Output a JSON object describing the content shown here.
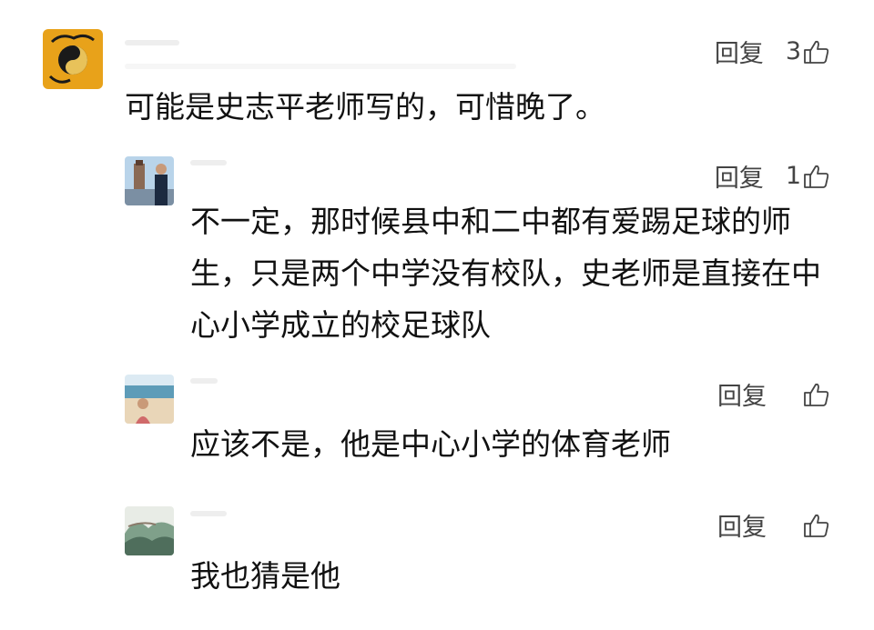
{
  "comments": [
    {
      "reply_label": "回复",
      "likes": "3",
      "text": "可能是史志平老师写的，可惜晚了。",
      "avatar_icon": "taiji-logo-icon",
      "accent": "#e8a21a"
    },
    {
      "reply_label": "回复",
      "likes": "1",
      "text": "不一定，那时候县中和二中都有爱踢足球的师生，只是两个中学没有校队，史老师是直接在中心小学成立的校足球队",
      "avatar_icon": "user-photo-icon"
    },
    {
      "reply_label": "回复",
      "likes": "",
      "text": "应该不是，他是中心小学的体育老师",
      "avatar_icon": "user-photo-icon"
    },
    {
      "reply_label": "回复",
      "likes": "",
      "text": "我也猜是他",
      "avatar_icon": "landscape-painting-icon"
    }
  ]
}
